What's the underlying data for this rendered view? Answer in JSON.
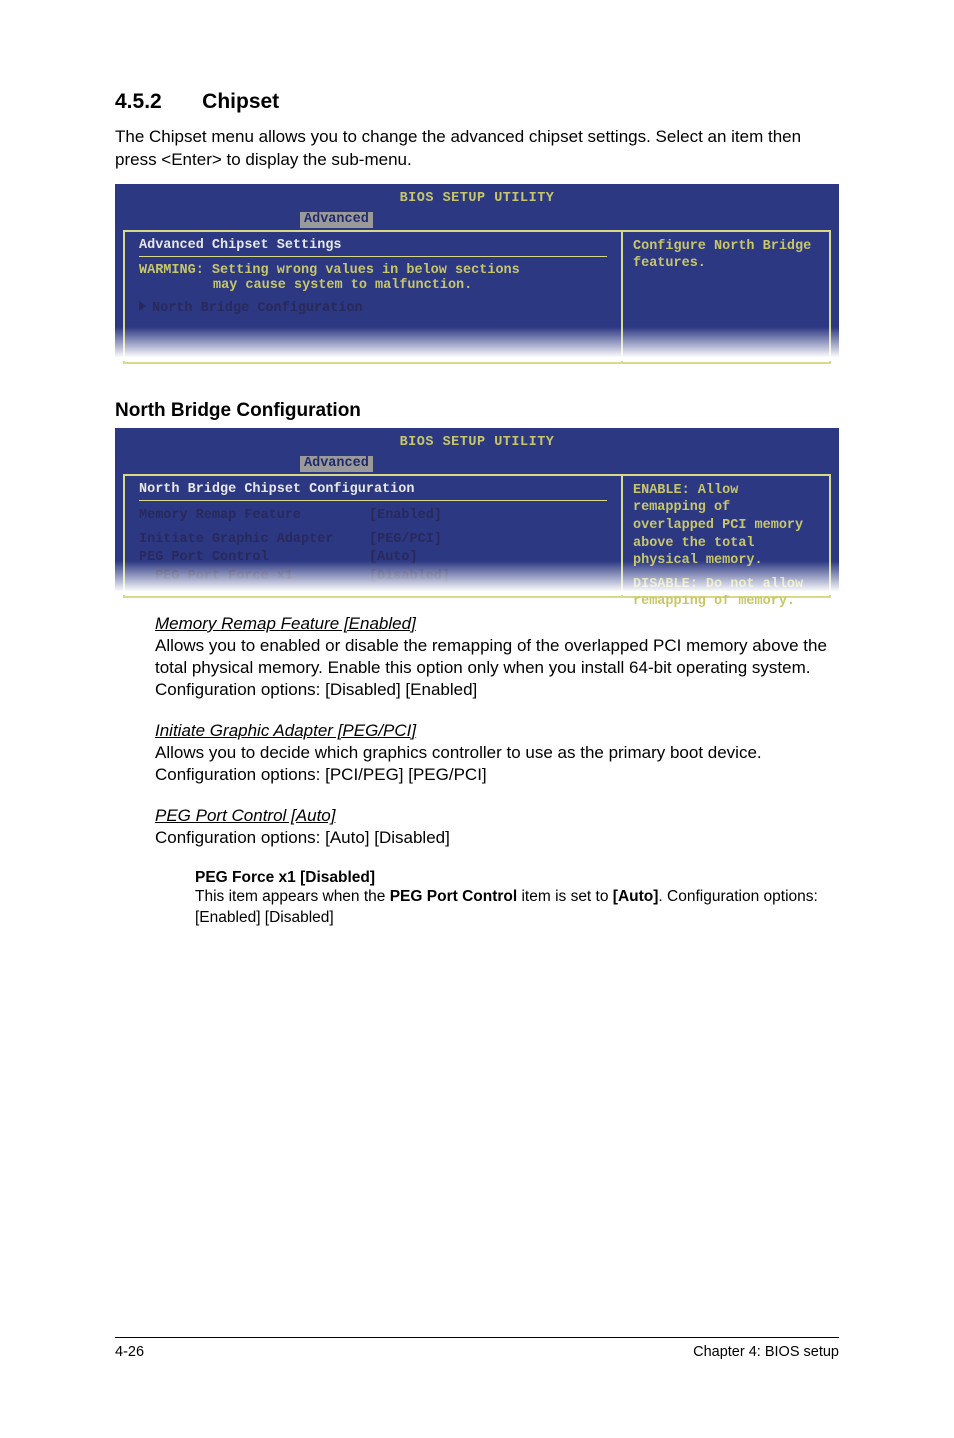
{
  "section": {
    "number": "4.5.2",
    "title": "Chipset"
  },
  "intro": "The Chipset menu allows you to change the advanced chipset settings. Select an item then press <Enter> to display the sub-menu.",
  "bios1": {
    "title": "BIOS SETUP UTILITY",
    "tab": "Advanced",
    "heading": "Advanced Chipset Settings",
    "warn1": "WARMING: Setting wrong values in below sections",
    "warn2": "may cause system to malfunction.",
    "submenu": "North Bridge Configuration",
    "help": "Configure North Bridge features."
  },
  "subheading": "North Bridge Configuration",
  "bios2": {
    "title": "BIOS SETUP UTILITY",
    "tab": "Advanced",
    "heading": "North Bridge Chipset Configuration",
    "rows": {
      "memory_remap": {
        "label": "Memory Remap Feature",
        "value": "[Enabled]"
      },
      "init_graphic": {
        "label": "Initiate Graphic Adapter",
        "value": "[PEG/PCI]"
      },
      "peg_control": {
        "label": "PEG Port Control",
        "value": "[Auto]"
      },
      "peg_force": {
        "label": "  PEG Port Force x1",
        "value": "[Disabled]"
      }
    },
    "help1": "ENABLE: Allow remapping of overlapped PCI memory above the total physical memory.",
    "help2": "DISABLE: Do not allow remapping of memory."
  },
  "items": {
    "memory_remap": {
      "title": "Memory Remap Feature [Enabled]",
      "body": "Allows you to enabled or disable the remapping of the overlapped PCI memory above the total physical memory. Enable this option only when you install 64-bit operating system. Configuration options: [Disabled] [Enabled]"
    },
    "init_graphic": {
      "title": "Initiate Graphic Adapter [PEG/PCI]",
      "body": "Allows you to decide which graphics controller to use as the primary boot device. Configuration options: [PCI/PEG] [PEG/PCI]"
    },
    "peg_control": {
      "title": "PEG Port Control [Auto]",
      "body": "Configuration options: [Auto] [Disabled]"
    },
    "peg_force": {
      "title": "PEG Force x1 [Disabled]",
      "body_prefix": "This item appears when the ",
      "body_bold1": "PEG Port Control",
      "body_mid": " item is set to ",
      "body_bold2": "[Auto]",
      "body_suffix": ". Configuration options: [Enabled] [Disabled]"
    }
  },
  "footer": {
    "left": "4-26",
    "right": "Chapter 4: BIOS setup"
  }
}
